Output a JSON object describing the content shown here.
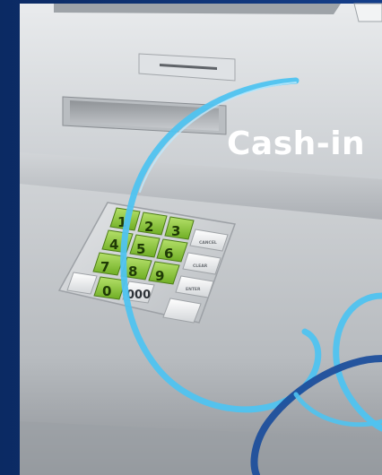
{
  "banner": {
    "title": "Cash-in"
  },
  "keypad": {
    "number_keys": [
      "1",
      "2",
      "3",
      "4",
      "5",
      "6",
      "7",
      "8",
      "9",
      "0"
    ],
    "extra_key": "000",
    "function_keys": [
      "CANCEL",
      "CLEAR",
      "ENTER"
    ]
  },
  "colors": {
    "frame_blue": "#0d2f6e",
    "swirl_light_blue": "#4fc3f0",
    "swirl_dark_blue": "#1d4f9c",
    "key_green": "#8cc63f",
    "atm_silver": "#c8cbcf"
  }
}
